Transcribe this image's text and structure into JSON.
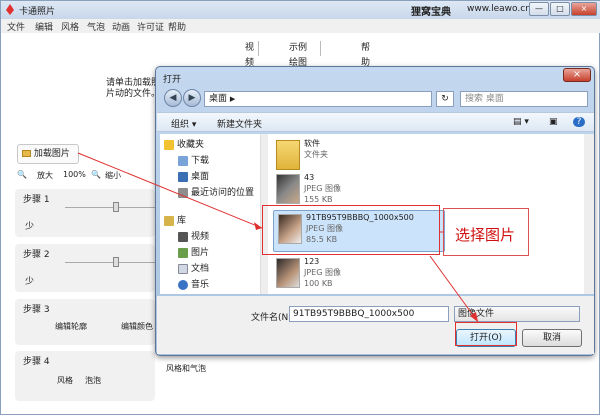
{
  "app": {
    "title": "卡通照片",
    "brand": "狸窝宝典",
    "site": "www.leawo.cn",
    "window_buttons": [
      "—",
      "□",
      "×"
    ],
    "menu": [
      "文件",
      "编辑",
      "风格",
      "气泡",
      "动画",
      "许可证",
      "帮助"
    ],
    "tabs": [
      "视频教程",
      "示例绘图 (Web)",
      "帮助"
    ],
    "hint": "请单击加载照片动的文件。",
    "load_button": "加载图片",
    "zoom": {
      "zoom_in": "放大",
      "percent": "100%",
      "zoom_out": "缩小"
    },
    "steps": [
      {
        "label": "步骤 1",
        "sub": "少"
      },
      {
        "label": "步骤 2",
        "sub": "少"
      },
      {
        "label": "步骤 3",
        "buttons": [
          "编辑轮廓",
          "编辑颜色"
        ]
      },
      {
        "label": "步骤 4",
        "buttons": [
          "风格",
          "泡泡",
          "风格和气泡"
        ]
      }
    ]
  },
  "dialog": {
    "title": "打开",
    "close": "×",
    "path": "桌面",
    "path_arrow": "▶",
    "refresh": "↻",
    "search_placeholder": "搜索 桌面",
    "toolbar": {
      "organize": "组织 ▾",
      "new_folder": "新建文件夹",
      "view": "▤ ▾",
      "pane": "▣",
      "help": "?"
    },
    "nav": {
      "favorites": "收藏夹",
      "items": [
        "下载",
        "桌面",
        "最近访问的位置"
      ],
      "library": "库",
      "lib_items": [
        "视频",
        "图片",
        "文档",
        "音乐"
      ]
    },
    "files": [
      {
        "name": "软件",
        "type": "文件夹",
        "size": ""
      },
      {
        "name": "43",
        "type": "JPEG 图像",
        "size": "155 KB"
      },
      {
        "name": "91TB95T9BBBQ_1000x500",
        "type": "JPEG 图像",
        "size": "85.5 KB"
      },
      {
        "name": "123",
        "type": "JPEG 图像",
        "size": "100 KB"
      }
    ],
    "filename_label": "文件名(N):",
    "filename_value": "91TB95T9BBBQ_1000x500",
    "filetype": "图像文件",
    "open_button": "打开(O)",
    "cancel_button": "取消"
  },
  "annotation": {
    "callout": "选择图片",
    "color": "#d01010"
  }
}
